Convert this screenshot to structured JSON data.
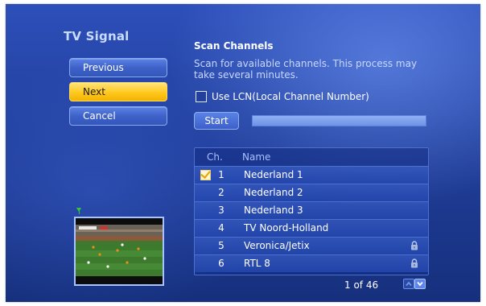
{
  "app": {
    "title": "TV Signal"
  },
  "nav": {
    "buttons": [
      {
        "label": "Previous"
      },
      {
        "label": "Next"
      },
      {
        "label": "Cancel"
      }
    ]
  },
  "scan": {
    "title": "Scan Channels",
    "description": "Scan for available channels. This process may take several minutes.",
    "lcn_label": "Use LCN(Local Channel Number)",
    "lcn_checked": false,
    "start_label": "Start",
    "progress": 1.0
  },
  "channels": {
    "headers": {
      "ch": "Ch.",
      "name": "Name"
    },
    "rows": [
      {
        "ch": "1",
        "name": "Nederland 1",
        "checked": true,
        "locked": false
      },
      {
        "ch": "2",
        "name": "Nederland 2",
        "checked": false,
        "locked": false
      },
      {
        "ch": "3",
        "name": "Nederland 3",
        "checked": false,
        "locked": false
      },
      {
        "ch": "4",
        "name": "TV Noord-Holland",
        "checked": false,
        "locked": false
      },
      {
        "ch": "5",
        "name": "Veronica/Jetix",
        "checked": false,
        "locked": true
      },
      {
        "ch": "6",
        "name": "RTL 8",
        "checked": false,
        "locked": true
      }
    ],
    "page_text": "1 of 46"
  },
  "colors": {
    "accent": "#ffc81e",
    "background": "#213f9c",
    "text": "#ffffff"
  }
}
